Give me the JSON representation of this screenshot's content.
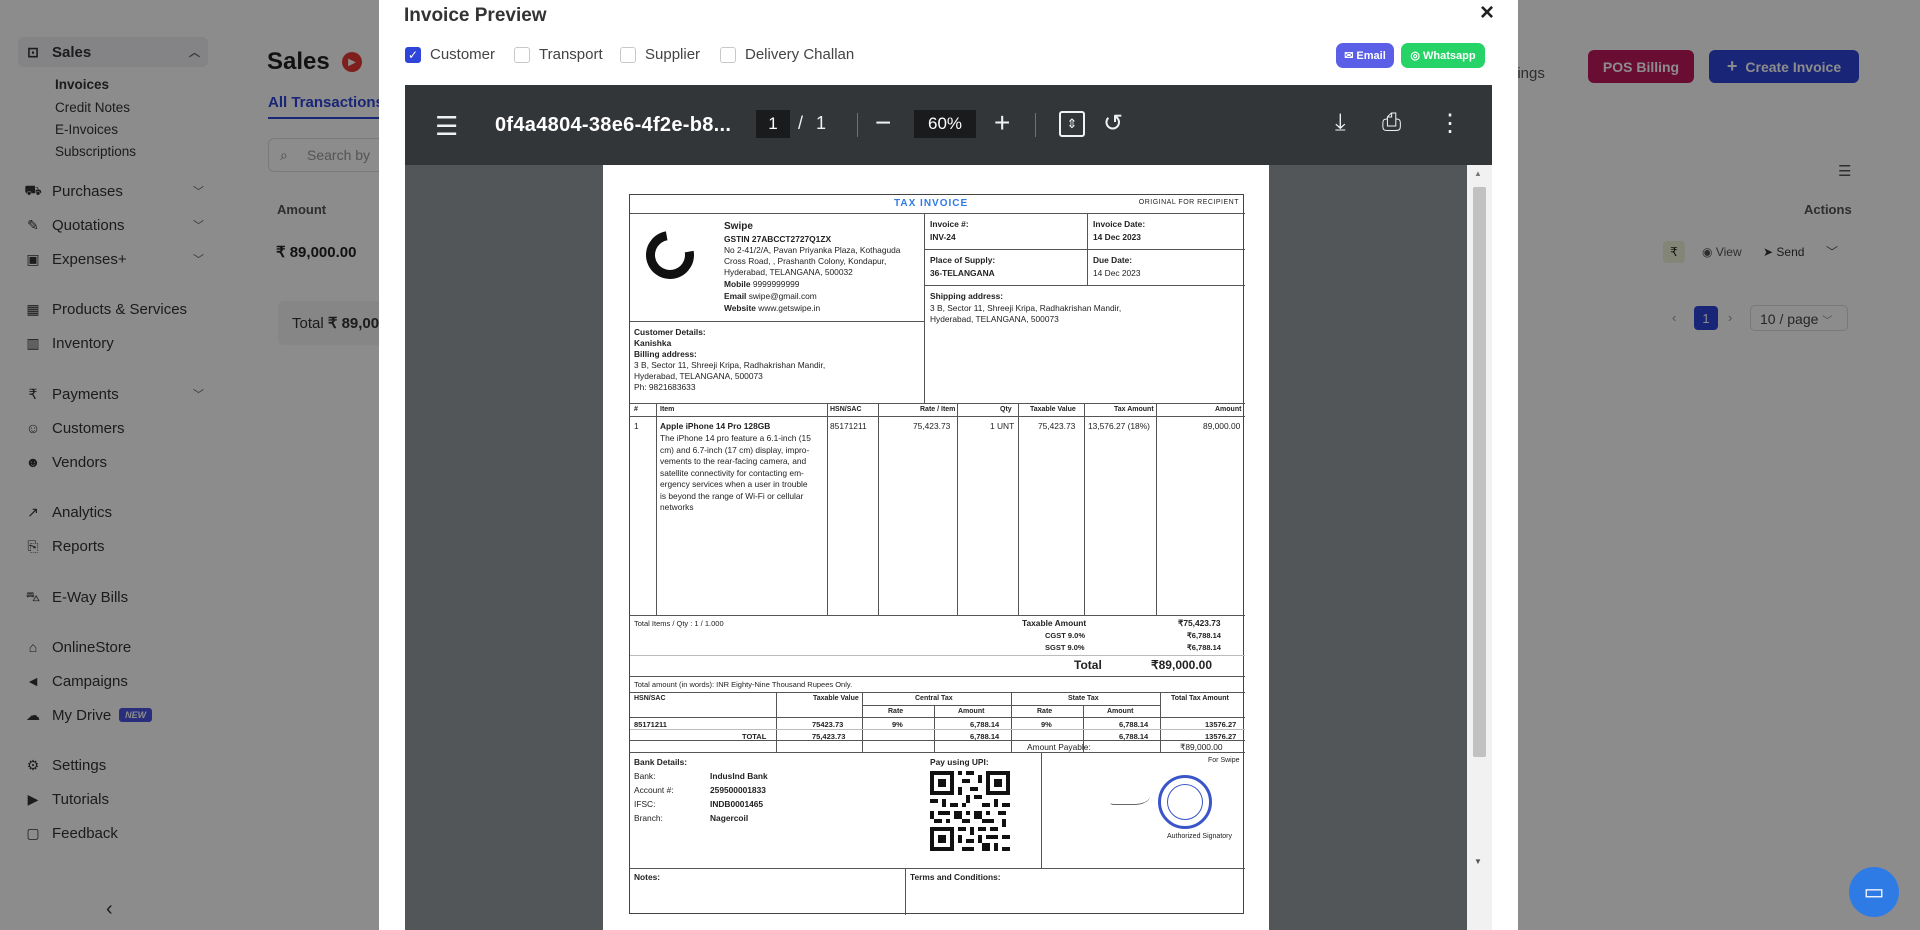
{
  "sidebar": {
    "sales": "Sales",
    "sub": [
      "Invoices",
      "Credit Notes",
      "E-Invoices",
      "Subscriptions"
    ],
    "items": [
      "Purchases",
      "Quotations",
      "Expenses+",
      "Products & Services",
      "Inventory",
      "Payments",
      "Customers",
      "Vendors",
      "Analytics",
      "Reports",
      "E-Way Bills",
      "OnlineStore",
      "Campaigns",
      "My Drive",
      "Settings",
      "Tutorials",
      "Feedback"
    ],
    "new_badge": "NEW",
    "collapse": "‹"
  },
  "main": {
    "title": "Sales",
    "tab": "All Transactions",
    "search_placeholder": "Search by",
    "amount_header": "Amount",
    "amount_value": "₹ 89,000.00",
    "total_label": "Total",
    "total_value": "₹ 89,00",
    "settings_link": "ttings",
    "pos_billing": "POS Billing",
    "create_invoice": "Create Invoice",
    "actions_header": "Actions",
    "view": "View",
    "send": "Send",
    "rupee": "₹",
    "page": "1",
    "page_size": "10 / page"
  },
  "modal": {
    "title": "Invoice Preview",
    "close": "×",
    "options": [
      {
        "label": "Customer",
        "checked": true
      },
      {
        "label": "Transport",
        "checked": false
      },
      {
        "label": "Supplier",
        "checked": false
      },
      {
        "label": "Delivery Challan",
        "checked": false
      }
    ],
    "email": "Email",
    "whatsapp": "Whatsapp",
    "colors": {
      "email": "#5b5fe8",
      "whatsapp": "#25d366",
      "primary": "#2f44d8",
      "pos": "#c2185b"
    }
  },
  "viewer": {
    "doc_name": "0f4a4804-38e6-4f2e-b8...",
    "page": "1",
    "page_sep": "/",
    "total_pages": "1",
    "zoom": "60%"
  },
  "invoice": {
    "heading": "TAX INVOICE",
    "copy": "ORIGINAL FOR RECIPIENT",
    "company": "Swipe",
    "gstin": "GSTIN 27ABCCT2727Q1ZX",
    "address1": "No 2-41/2/A, Pavan Priyanka Plaza, Kothaguda",
    "address2": "Cross Road, , Prashanth Colony, Kondapur,",
    "address3": "Hyderabad, TELANGANA, 500032",
    "mobile_label": "Mobile",
    "mobile": "9999999999",
    "email_label": "Email",
    "email": "swipe@gmail.com",
    "website_label": "Website",
    "website": "www.getswipe.in",
    "invoice_no_label": "Invoice #:",
    "invoice_no": "INV-24",
    "invoice_date_label": "Invoice Date:",
    "invoice_date": "14 Dec 2023",
    "place_label": "Place of Supply:",
    "place": "36-TELANGANA",
    "due_label": "Due Date:",
    "due": "14 Dec 2023",
    "ship_label": "Shipping address:",
    "ship1": "3 B, Sector 11, Shreeji Kripa, Radhakrishan Mandir,",
    "ship2": "Hyderabad, TELANGANA, 500073",
    "cust_label": "Customer Details:",
    "cust_name": "Kanishka",
    "bill_label": "Billing address:",
    "bill1": "3 B, Sector 11, Shreeji Kripa, Radhakrishan Mandir,",
    "bill2": "Hyderabad, TELANGANA, 500073",
    "phone": "Ph: 9821683633",
    "cols": [
      "#",
      "Item",
      "HSN/SAC",
      "Rate / Item",
      "Qty",
      "Taxable Value",
      "Tax Amount",
      "Amount"
    ],
    "row": {
      "no": "1",
      "item": "Apple iPhone 14 Pro 128GB",
      "desc": [
        "The iPhone 14 pro feature a 6.1-inch (15",
        "cm) and 6.7-inch (17 cm) display, impro-",
        "vements to the rear-facing camera, and",
        "satellite connectivity for contacting em-",
        "ergency services when a user in trouble",
        "is beyond the range of Wi-Fi or cellular",
        "networks"
      ],
      "hsn": "85171211",
      "rate": "75,423.73",
      "qty": "1 UNT",
      "taxable": "75,423.73",
      "tax": "13,576.27 (18%)",
      "amount": "89,000.00"
    },
    "total_items": "Total Items / Qty : 1 / 1.000",
    "taxable_label": "Taxable Amount",
    "taxable_value": "₹75,423.73",
    "cgst_label": "CGST 9.0%",
    "cgst_value": "₹6,788.14",
    "sgst_label": "SGST 9.0%",
    "sgst_value": "₹6,788.14",
    "total_label": "Total",
    "total_value": "₹89,000.00",
    "words": "Total amount (in words): INR Eighty-Nine Thousand Rupees Only.",
    "tax_head": [
      "HSN/SAC",
      "Taxable Value",
      "Central Tax",
      "State Tax",
      "Total Tax Amount"
    ],
    "tax_sub": [
      "Rate",
      "Amount",
      "Rate",
      "Amount"
    ],
    "tax_row": [
      "85171211",
      "75423.73",
      "9%",
      "6,788.14",
      "9%",
      "6,788.14",
      "13576.27"
    ],
    "tax_total": [
      "TOTAL",
      "75,423.73",
      "6,788.14",
      "6,788.14",
      "13576.27"
    ],
    "payable_label": "Amount Payable:",
    "payable_value": "₹89,000.00",
    "bank_label": "Bank Details:",
    "bank_rows": [
      [
        "Bank:",
        "IndusInd Bank"
      ],
      [
        "Account #:",
        "259500001833"
      ],
      [
        "IFSC:",
        "INDB0001465"
      ],
      [
        "Branch:",
        "Nagercoil"
      ]
    ],
    "upi_label": "Pay using UPI:",
    "for": "For Swipe",
    "sign": "Authorized Signatory",
    "notes_label": "Notes:",
    "terms_label": "Terms and Conditions:"
  }
}
